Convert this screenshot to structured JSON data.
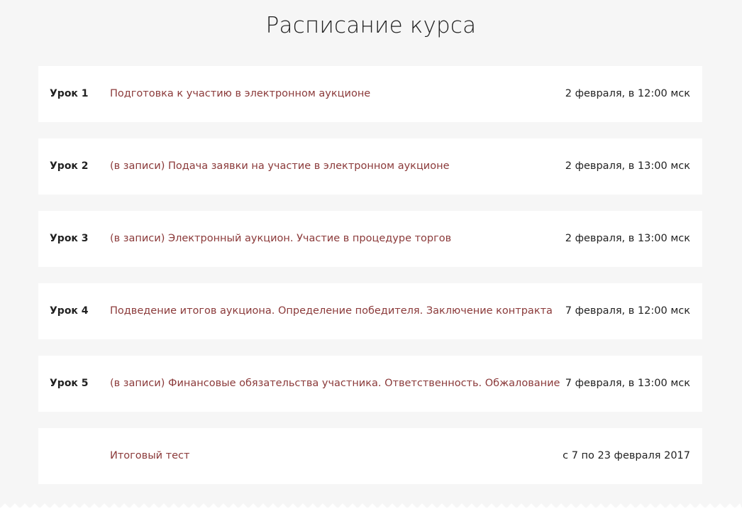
{
  "page_title": "Расписание курса",
  "lessons": [
    {
      "number": "Урок 1",
      "title": "Подготовка к участию в электронном аукционе",
      "date": "2 февраля, в 12:00 мск"
    },
    {
      "number": "Урок 2",
      "title": "(в записи) Подача заявки на участие в электронном аукционе",
      "date": "2 февраля, в 13:00 мск"
    },
    {
      "number": "Урок 3",
      "title": "(в записи) Электронный аукцион. Участие в процедуре торгов",
      "date": "2 февраля, в 13:00 мск"
    },
    {
      "number": "Урок 4",
      "title": "Подведение итогов аукциона. Определение победителя. Заключение контракта",
      "date": "7 февраля, в 12:00 мск"
    },
    {
      "number": "Урок 5",
      "title": "(в записи) Финансовые обязательства участника. Ответственность. Обжалование",
      "date": "7 февраля, в 13:00 мск"
    },
    {
      "number": "",
      "title": "Итоговый тест",
      "date": "с 7 по 23 февраля 2017"
    }
  ],
  "colors": {
    "background": "#f6f6f6",
    "card": "#ffffff",
    "link": "#8b3a3a",
    "text": "#222222"
  }
}
